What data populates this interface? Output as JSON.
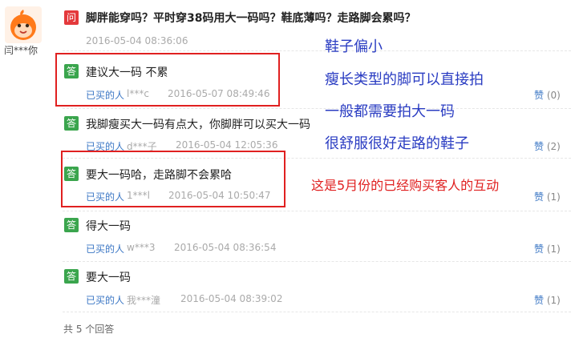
{
  "asker": {
    "name": "闫***你"
  },
  "question": {
    "badge": "问",
    "text": "脚胖能穿吗？平时穿38码用大一码吗？鞋底薄吗？走路脚会累吗？",
    "date": "2016-05-04 08:36:06"
  },
  "answers": [
    {
      "badge": "答",
      "text": "建议大一码 不累",
      "buyer": "已买的人",
      "user": "l***c",
      "date": "2016-05-07 08:49:46",
      "like_label": "赞",
      "likes": "(0)"
    },
    {
      "badge": "答",
      "text": "我脚瘦买大一码有点大，你脚胖可以买大一码",
      "buyer": "已买的人",
      "user": "d***子",
      "date": "2016-05-04 12:05:36",
      "like_label": "赞",
      "likes": "(2)"
    },
    {
      "badge": "答",
      "text": "要大一码哈，走路脚不会累哈",
      "buyer": "已买的人",
      "user": "1***l",
      "date": "2016-05-04 10:50:47",
      "like_label": "赞",
      "likes": "(1)"
    },
    {
      "badge": "答",
      "text": "得大一码",
      "buyer": "已买的人",
      "user": "w***3",
      "date": "2016-05-04 08:36:54",
      "like_label": "赞",
      "likes": "(1)"
    },
    {
      "badge": "答",
      "text": "要大一码",
      "buyer": "已买的人",
      "user": "我***潼",
      "date": "2016-05-04 08:39:02",
      "like_label": "赞",
      "likes": "(1)"
    }
  ],
  "annotations": {
    "notes": [
      "鞋子偏小",
      "瘦长类型的脚可以直接拍",
      "一般都需要拍大一码",
      "很舒服很好走路的鞋子"
    ],
    "red_note": "这是5月份的已经购买客人的互动"
  },
  "footer": {
    "count_text": "共 5 个回答"
  },
  "colors": {
    "question_badge": "#e4393c",
    "answer_badge": "#3aa54d",
    "link": "#3a76c4",
    "note_blue": "#2a3cc2",
    "note_red": "#e02020"
  }
}
